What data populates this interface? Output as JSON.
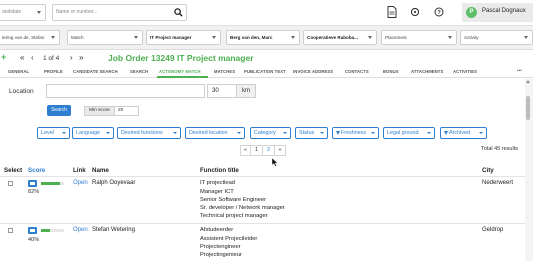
{
  "topbar": {
    "candidate_select": "andidate",
    "name_input_placeholder": "Name or number...",
    "user_initial": "P",
    "user_name": "Pascal Dognaux",
    "icons": [
      "search-icon",
      "document-icon",
      "refresh-icon",
      "help-icon"
    ]
  },
  "filterbar": {
    "items": [
      {
        "label": "tering van de, Stefan",
        "bold": false
      },
      {
        "label": "Match",
        "bold": false
      },
      {
        "label": "IT Project manager",
        "bold": true
      },
      {
        "label": "Berg van den, Marc",
        "bold": true
      },
      {
        "label": "Cooperatieve Raboba...",
        "bold": true
      },
      {
        "label": "Placement",
        "bold": false
      },
      {
        "label": "Activity",
        "bold": false
      }
    ]
  },
  "nav": {
    "page_info": "1 of 4",
    "job_title": "Job Order 13249 IT Project manager"
  },
  "tabs": [
    {
      "label": "GENERAL",
      "active": false
    },
    {
      "label": "PROFILE",
      "active": false
    },
    {
      "label": "CANDIDATE SEARCH",
      "active": false
    },
    {
      "label": "SEARCH",
      "active": false
    },
    {
      "label": "ACTONOMY MATCH",
      "active": true
    },
    {
      "label": "MATCHES",
      "active": false
    },
    {
      "label": "PUBLICATION TEXT",
      "active": false
    },
    {
      "label": "INVOICE ADDRESS",
      "active": false
    },
    {
      "label": "CONTACTS",
      "active": false
    },
    {
      "label": "BONUS",
      "active": false
    },
    {
      "label": "ATTACHMENTS",
      "active": false
    },
    {
      "label": "ACTIVITIES",
      "active": false
    },
    {
      "label": "•••",
      "active": false
    }
  ],
  "search_form": {
    "location_label": "Location",
    "location_value": "",
    "radius_value": "30",
    "radius_unit": "km",
    "search_button": "Search",
    "min_score_label": "Min score",
    "min_score_value": "20"
  },
  "facets": [
    "Level",
    "Language",
    "Desired functions",
    "Desired location",
    "Category",
    "Status",
    "Freshness",
    "Legal ground",
    "Archived"
  ],
  "pagination": {
    "prev": "«",
    "pages": [
      "1",
      "2"
    ],
    "active_page": "2",
    "next": "»",
    "total": "Total 45 results"
  },
  "table": {
    "headers": {
      "select": "Select",
      "score": "Score",
      "link": "Link",
      "name": "Name",
      "function_title": "Function title",
      "city": "City"
    },
    "rows": [
      {
        "score": 0.82,
        "score_label": "82%",
        "link": "Open",
        "name": "Ralph Ooyevaar",
        "function_titles": [
          "IT projectlead",
          "Manager ICT",
          "Senior Software Engineer",
          "Sr. developer / Network manager",
          "Technical project manager"
        ],
        "city": "Nederweert"
      },
      {
        "score": 0.4,
        "score_label": "40%",
        "link": "Open",
        "name": "Stefan Wetering",
        "function_titles": [
          "Afstudeerder",
          "Assistent Projectleider",
          "Projectengineer",
          "Projectingenieur"
        ],
        "city": "Geldrop"
      }
    ]
  },
  "colors": {
    "accent_blue": "#2f7fd1",
    "accent_green": "#4caf50"
  }
}
